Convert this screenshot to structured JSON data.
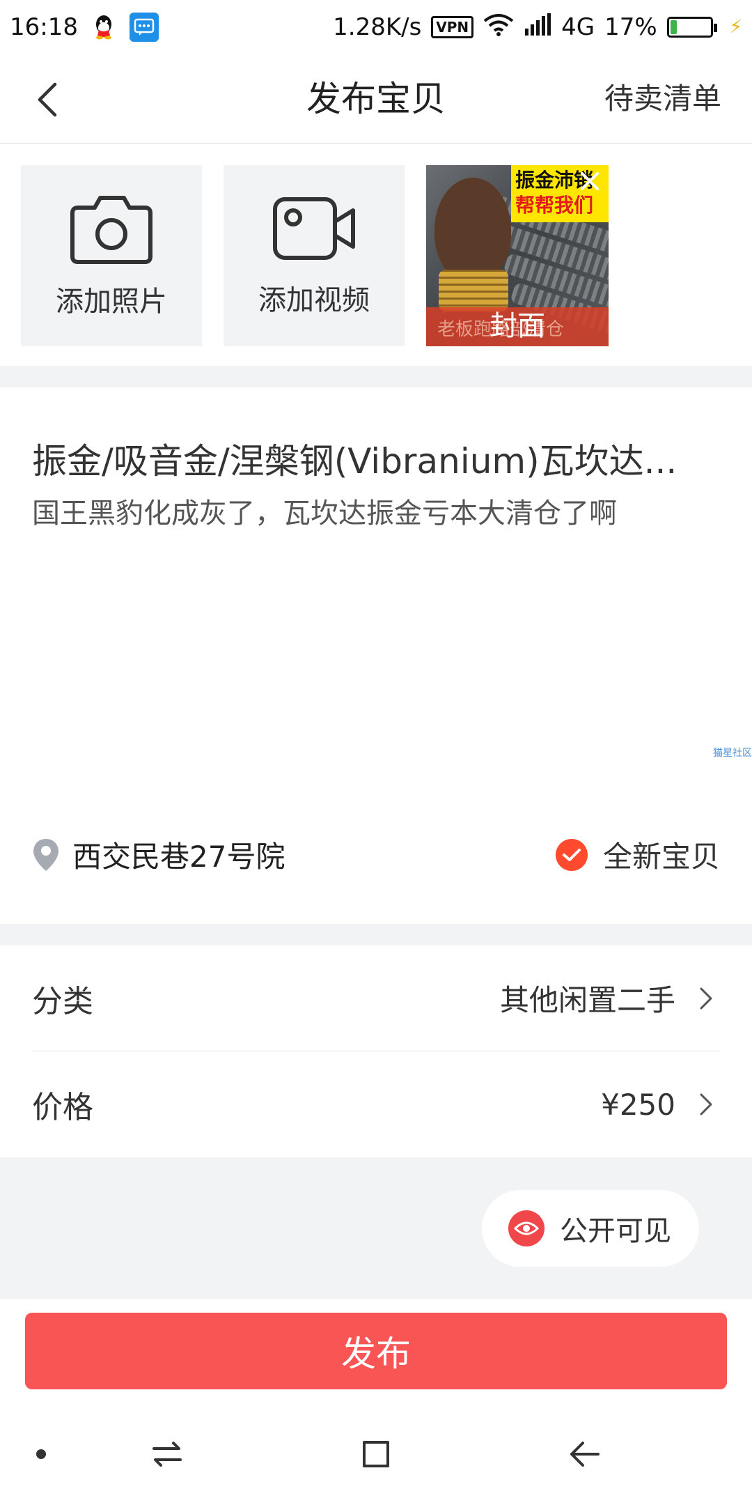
{
  "status_bar": {
    "time": "16:18",
    "net_speed": "1.28K/s",
    "vpn": "VPN",
    "network": "4G",
    "battery": "17%",
    "battery_level": 0.17,
    "icons": [
      "qq-icon",
      "message-icon",
      "wifi-icon",
      "signal-icon",
      "battery-icon",
      "charging-icon"
    ]
  },
  "header": {
    "title": "发布宝贝",
    "right_action": "待卖清单"
  },
  "media": {
    "add_photo": "添加照片",
    "add_video": "添加视频",
    "cover": {
      "label": "封面",
      "banner_line1": "振金沛销",
      "banner_line2": "帮帮我们",
      "bottom_text": "老板跑路部清仓"
    }
  },
  "listing": {
    "title": "振金/吸音金/涅槃钢(Vibranium)瓦坎达...",
    "description": "国王黑豹化成灰了，瓦坎达振金亏本大清仓了啊",
    "watermark": "猫星社区",
    "location": "西交民巷27号院",
    "condition": "全新宝贝"
  },
  "form": {
    "category_label": "分类",
    "category_value": "其他闲置二手",
    "price_label": "价格",
    "price_value": "¥250"
  },
  "visibility": {
    "label": "公开可见"
  },
  "actions": {
    "publish": "发布"
  },
  "colors": {
    "accent": "#fa5555",
    "check": "#ff4a2d",
    "eye": "#f0484a",
    "background": "#f2f3f5"
  }
}
